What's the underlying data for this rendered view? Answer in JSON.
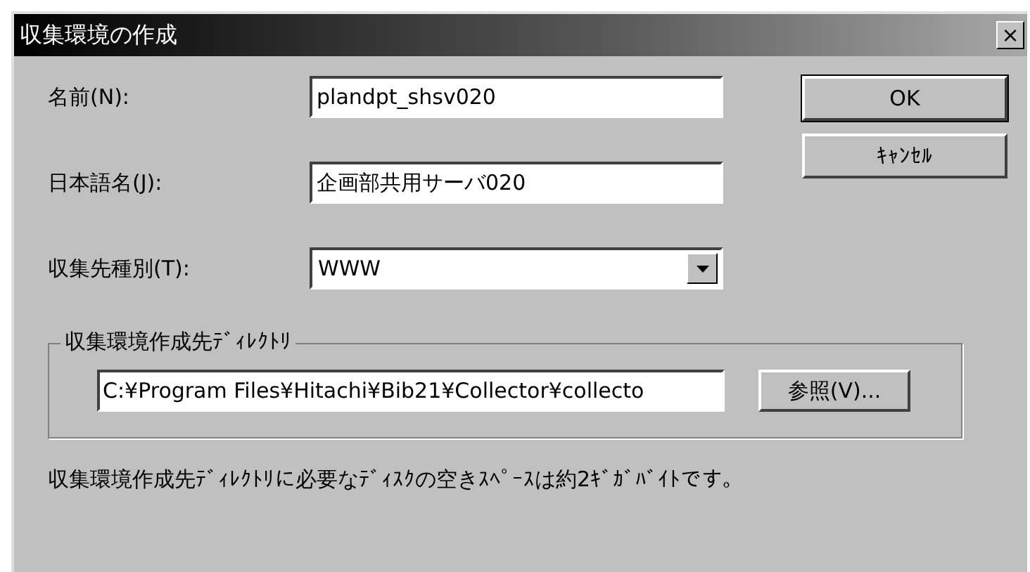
{
  "window": {
    "title": "収集環境の作成",
    "close": "×"
  },
  "fields": [
    {
      "kind": "text",
      "label": "名前(N):",
      "value": "plandpt_shsv020"
    },
    {
      "kind": "text",
      "label": "日本語名(J):",
      "value": "企画部共用サーバ020"
    },
    {
      "kind": "combo",
      "label": "収集先種別(T):",
      "value": "WWW"
    }
  ],
  "buttons": [
    {
      "label": "OK",
      "default": true
    },
    {
      "label": "ｷｬﾝｾﾙ",
      "default": false
    }
  ],
  "directory_group": {
    "title": "収集環境作成先ﾃﾞｨﾚｸﾄﾘ",
    "path": "C:¥Program Files¥Hitachi¥Bib21¥Collector¥collecto",
    "browse": "参照(V)..."
  },
  "note": "収集環境作成先ﾃﾞｨﾚｸﾄﾘに必要なﾃﾞｨｽｸの空きｽﾍﾟｰｽは約2ｷﾞｶﾞﾊﾞｲﾄです。"
}
